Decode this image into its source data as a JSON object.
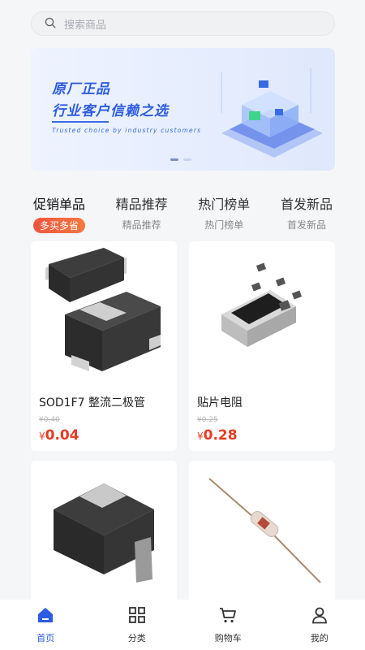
{
  "search": {
    "placeholder": "搜索商品"
  },
  "banner": {
    "line1": "原厂正品",
    "line2": "行业客户信赖之选",
    "line3": "Trusted choice by industry customers",
    "active_slide": 1,
    "slide_count": 2
  },
  "tabs": [
    {
      "title": "促销单品",
      "subtitle": "多买多省",
      "active": true
    },
    {
      "title": "精品推荐",
      "subtitle": "精品推荐"
    },
    {
      "title": "热门榜单",
      "subtitle": "热门榜单"
    },
    {
      "title": "首发新品",
      "subtitle": "首发新品"
    }
  ],
  "products": [
    {
      "name": "SOD1F7 整流二极管",
      "original_price": "¥0.40",
      "currency": "¥",
      "price": "0.04"
    },
    {
      "name": "贴片电阻",
      "original_price": "¥0.25",
      "currency": "¥",
      "price": "0.28"
    },
    {
      "name": "",
      "original_price": "",
      "currency": "",
      "price": ""
    },
    {
      "name": "",
      "original_price": "",
      "currency": "",
      "price": ""
    }
  ],
  "bottom_nav": [
    {
      "label": "首页",
      "icon": "home-icon",
      "active": true
    },
    {
      "label": "分类",
      "icon": "grid-icon"
    },
    {
      "label": "购物车",
      "icon": "cart-icon"
    },
    {
      "label": "我的",
      "icon": "user-icon"
    }
  ],
  "colors": {
    "accent": "#2c5ce0",
    "price": "#e63c21",
    "promo_badge": "#f0533f"
  }
}
